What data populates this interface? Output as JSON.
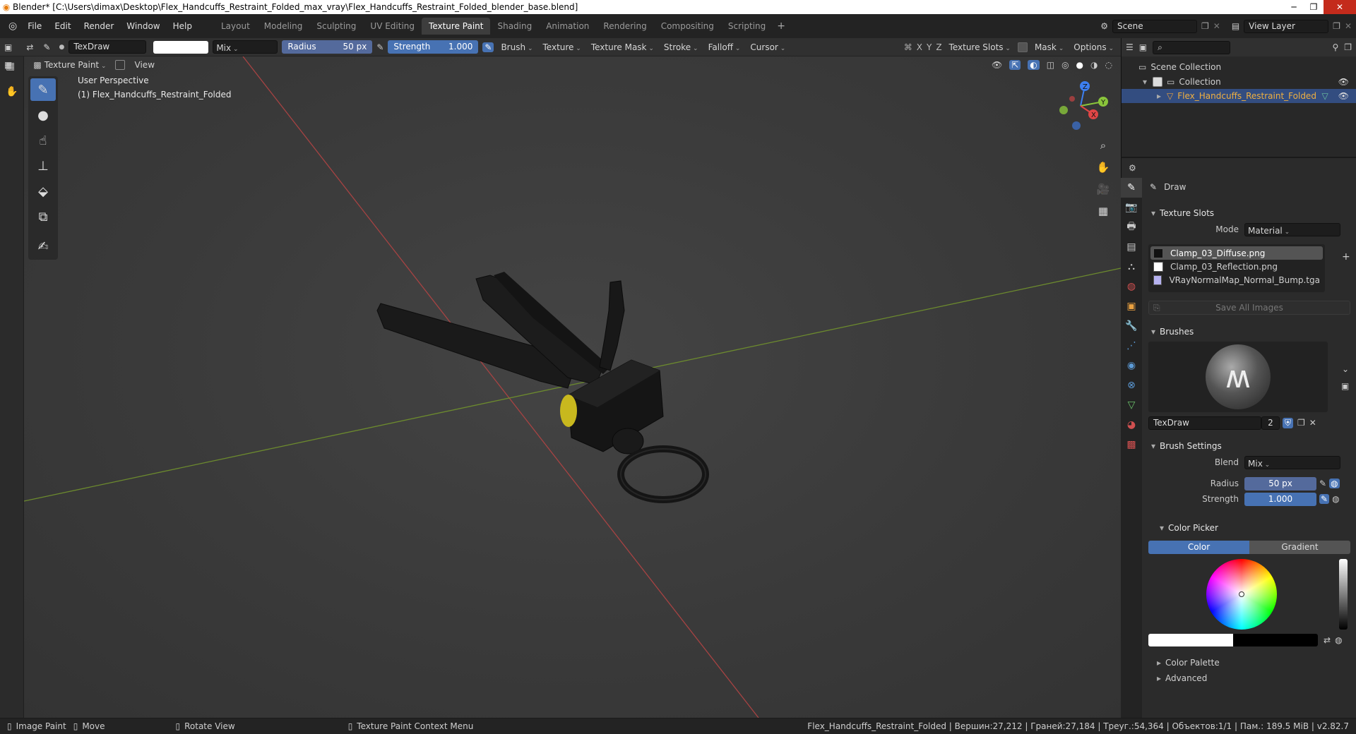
{
  "window": {
    "title": "Blender* [C:\\Users\\dimax\\Desktop\\Flex_Handcuffs_Restraint_Folded_max_vray\\Flex_Handcuffs_Restraint_Folded_blender_base.blend]"
  },
  "menu": [
    "File",
    "Edit",
    "Render",
    "Window",
    "Help"
  ],
  "workspaces": [
    {
      "label": "Layout",
      "active": false
    },
    {
      "label": "Modeling",
      "active": false
    },
    {
      "label": "Sculpting",
      "active": false
    },
    {
      "label": "UV Editing",
      "active": false
    },
    {
      "label": "Texture Paint",
      "active": true
    },
    {
      "label": "Shading",
      "active": false
    },
    {
      "label": "Animation",
      "active": false
    },
    {
      "label": "Rendering",
      "active": false
    },
    {
      "label": "Compositing",
      "active": false
    },
    {
      "label": "Scripting",
      "active": false
    }
  ],
  "scene": {
    "name": "Scene",
    "view_layer": "View Layer"
  },
  "tool_header": {
    "brush_name": "TexDraw",
    "blend": "Mix",
    "radius_label": "Radius",
    "radius_value": "50 px",
    "strength_label": "Strength",
    "strength_value": "1.000",
    "menus": [
      "Brush",
      "Texture",
      "Texture Mask",
      "Stroke",
      "Falloff",
      "Cursor"
    ],
    "axes": [
      "X",
      "Y",
      "Z"
    ],
    "right_menus": [
      "Texture Slots",
      "Mask",
      "Options"
    ]
  },
  "view_header": {
    "mode": "Texture Paint",
    "view": "View"
  },
  "viewport": {
    "perspective": "User Perspective",
    "object_label": "(1) Flex_Handcuffs_Restraint_Folded"
  },
  "gizmo": {
    "z": "Z",
    "y": "Y",
    "x": "X"
  },
  "outliner": {
    "root": "Scene Collection",
    "collection": "Collection",
    "object": "Flex_Handcuffs_Restraint_Folded"
  },
  "properties": {
    "tool_title": "Draw",
    "texture_slots": {
      "header": "Texture Slots",
      "mode_label": "Mode",
      "mode_value": "Material",
      "slots": [
        {
          "name": "Clamp_03_Diffuse.png",
          "color": "#111111",
          "selected": true
        },
        {
          "name": "Clamp_03_Reflection.png",
          "color": "#ffffff",
          "selected": false
        },
        {
          "name": "VRayNormalMap_Normal_Bump.tga",
          "color": "#b6b2f0",
          "selected": false
        }
      ],
      "save_all": "Save All Images"
    },
    "brushes": {
      "header": "Brushes",
      "name": "TexDraw",
      "users": "2"
    },
    "brush_settings": {
      "header": "Brush Settings",
      "blend_label": "Blend",
      "blend_value": "Mix",
      "radius_label": "Radius",
      "radius_value": "50 px",
      "strength_label": "Strength",
      "strength_value": "1.000"
    },
    "color_picker": {
      "header": "Color Picker",
      "tab_color": "Color",
      "tab_gradient": "Gradient"
    },
    "color_palette": "Color Palette",
    "advanced": "Advanced"
  },
  "statusbar": {
    "items": [
      "Image Paint",
      "Move",
      "Rotate View",
      "Texture Paint Context Menu"
    ],
    "stats": "Flex_Handcuffs_Restraint_Folded | Вершин:27,212 | Граней:27,184 | Треуг.:54,364 | Объектов:1/1 | Пам.: 189.5 MiB | v2.82.7"
  },
  "colors": {
    "accent": "#4772b3",
    "selected_row": "#334d80",
    "axis_x": "#e04646",
    "axis_y": "#8ac53b",
    "axis_z": "#3d7ff0"
  }
}
